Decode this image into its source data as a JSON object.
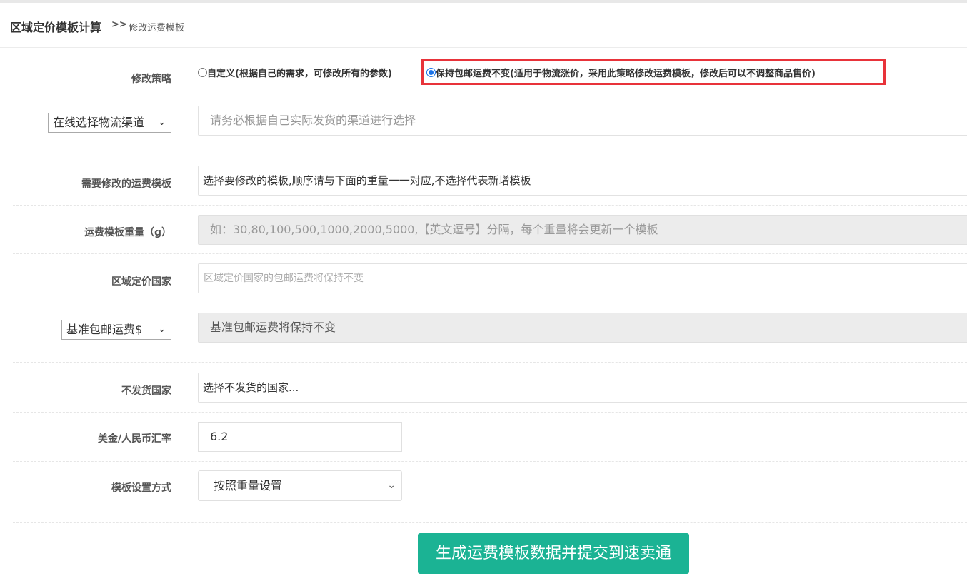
{
  "breadcrumb": {
    "main": "区域定价模板计算",
    "sep": ">>",
    "current": "修改运费模板"
  },
  "strategy": {
    "label": "修改策略",
    "options": [
      {
        "text": "自定义(根据自己的需求，可修改所有的参数)",
        "checked": false
      },
      {
        "text": "保持包邮运费不变(适用于物流涨价，采用此策略修改运费模板，修改后可以不调整商品售价)",
        "checked": true
      }
    ]
  },
  "channel": {
    "select": "在线选择物流渠道",
    "placeholder": "请务必根据自己实际发货的渠道进行选择"
  },
  "template": {
    "label": "需要修改的运费模板",
    "value": "选择要修改的模板,顺序请与下面的重量一一对应,不选择代表新增模板"
  },
  "weight": {
    "label": "运费模板重量（g）",
    "placeholder": "如：30,80,100,500,1000,2000,5000,【英文逗号】分隔，每个重量将会更新一个模板"
  },
  "region": {
    "label": "区域定价国家",
    "placeholder": "区域定价国家的包邮运费将保持不变"
  },
  "base": {
    "select": "基准包邮运费$",
    "value": "基准包邮运费将保持不变"
  },
  "noship": {
    "label": "不发货国家",
    "value": "选择不发货的国家..."
  },
  "rate": {
    "label": "美金/人民币汇率",
    "value": "6.2"
  },
  "mode": {
    "label": "模板设置方式",
    "value": "按照重量设置"
  },
  "submit": {
    "label": "生成运费模板数据并提交到速卖通"
  },
  "colors": {
    "accent": "#1bb394",
    "highlight": "#e8333a",
    "radio": "#1a73e8"
  }
}
